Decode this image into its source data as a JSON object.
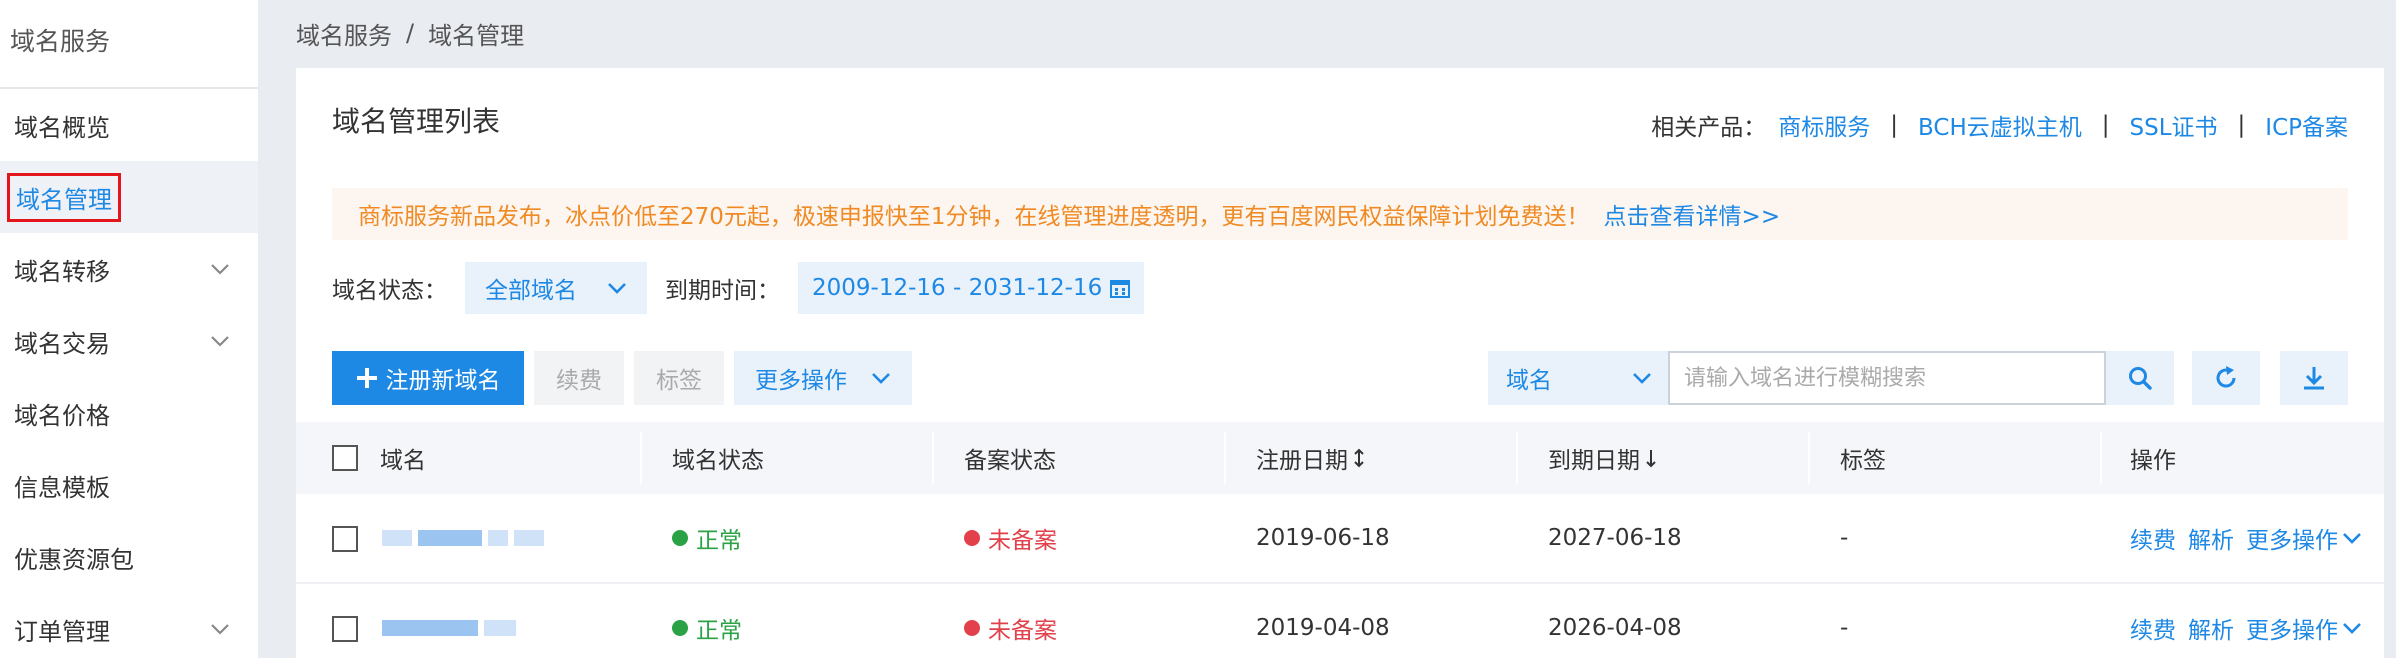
{
  "sidebar": {
    "title": "域名服务",
    "items": [
      {
        "label": "域名概览",
        "expandable": false,
        "active": false
      },
      {
        "label": "域名管理",
        "expandable": false,
        "active": true
      },
      {
        "label": "域名转移",
        "expandable": true,
        "active": false
      },
      {
        "label": "域名交易",
        "expandable": true,
        "active": false
      },
      {
        "label": "域名价格",
        "expandable": false,
        "active": false
      },
      {
        "label": "信息模板",
        "expandable": false,
        "active": false
      },
      {
        "label": "优惠资源包",
        "expandable": false,
        "active": false
      },
      {
        "label": "订单管理",
        "expandable": true,
        "active": false
      }
    ]
  },
  "breadcrumb": {
    "root": "域名服务",
    "separator": "/",
    "current": "域名管理"
  },
  "card": {
    "title": "域名管理列表",
    "related_label": "相关产品：",
    "related_links": [
      "商标服务",
      "BCH云虚拟主机",
      "SSL证书",
      "ICP备案"
    ],
    "related_separator": "|"
  },
  "notice": {
    "text": "商标服务新品发布，冰点价低至270元起，极速申报快至1分钟，在线管理进度透明，更有百度网民权益保障计划免费送！",
    "link": "点击查看详情>>"
  },
  "filter": {
    "status_label": "域名状态：",
    "status_value": "全部域名",
    "expiry_label": "到期时间：",
    "date_range": "2009-12-16 - 2031-12-16"
  },
  "toolbar": {
    "register_label": "注册新域名",
    "renew_label": "续费",
    "tag_label": "标签",
    "more_label": "更多操作",
    "search_type": "域名",
    "search_placeholder": "请输入域名进行模糊搜索"
  },
  "table": {
    "headers": {
      "domain": "域名",
      "status": "域名状态",
      "icp": "备案状态",
      "reg_date": "注册日期",
      "exp_date": "到期日期",
      "tag": "标签",
      "ops": "操作"
    },
    "rows": [
      {
        "status": "正常",
        "icp": "未备案",
        "reg_date": "2019-06-18",
        "exp_date": "2027-06-18",
        "tag": "-"
      },
      {
        "status": "正常",
        "icp": "未备案",
        "reg_date": "2019-04-08",
        "exp_date": "2026-04-08",
        "tag": "-"
      }
    ],
    "ops": {
      "renew": "续费",
      "dns": "解析",
      "more": "更多操作"
    }
  },
  "colors": {
    "accent": "#1e88e5",
    "success": "#2ba245",
    "danger": "#e2404a",
    "warning": "#f08a24",
    "highlight": "#e2161c"
  }
}
